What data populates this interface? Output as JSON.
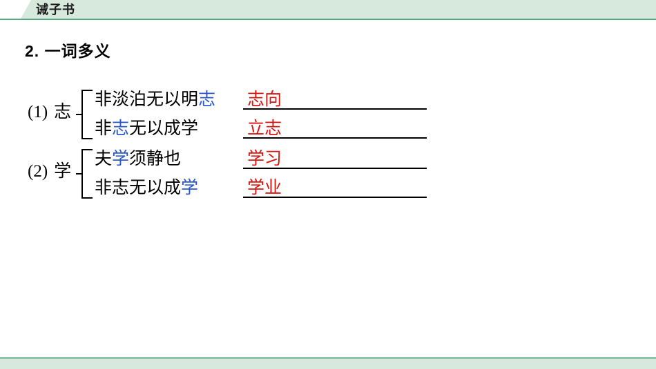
{
  "header": {
    "title": "诫子书",
    "bg_color": "#d7e8dd",
    "rule_color": "#5aa882"
  },
  "section": {
    "title": "2. 一词多义"
  },
  "colors": {
    "highlight_blue": "#2a58cc",
    "answer_red": "#d8140f",
    "text_black": "#000000"
  },
  "groups": [
    {
      "index": "(1)",
      "key": "志",
      "rows": [
        {
          "sentence_pre": "非淡泊无以明",
          "sentence_hl": "志",
          "sentence_post": "",
          "answer": "志向"
        },
        {
          "sentence_pre": "非",
          "sentence_hl": "志",
          "sentence_post": "无以成学",
          "answer": "立志"
        }
      ]
    },
    {
      "index": "(2)",
      "key": "学",
      "rows": [
        {
          "sentence_pre": "夫",
          "sentence_hl": "学",
          "sentence_post": "须静也",
          "answer": "学习"
        },
        {
          "sentence_pre": "非志无以成",
          "sentence_hl": "学",
          "sentence_post": "",
          "answer": "学业"
        }
      ]
    }
  ],
  "footer": {
    "bg_color": "#d7e8dd",
    "border_color": "#77b894"
  }
}
